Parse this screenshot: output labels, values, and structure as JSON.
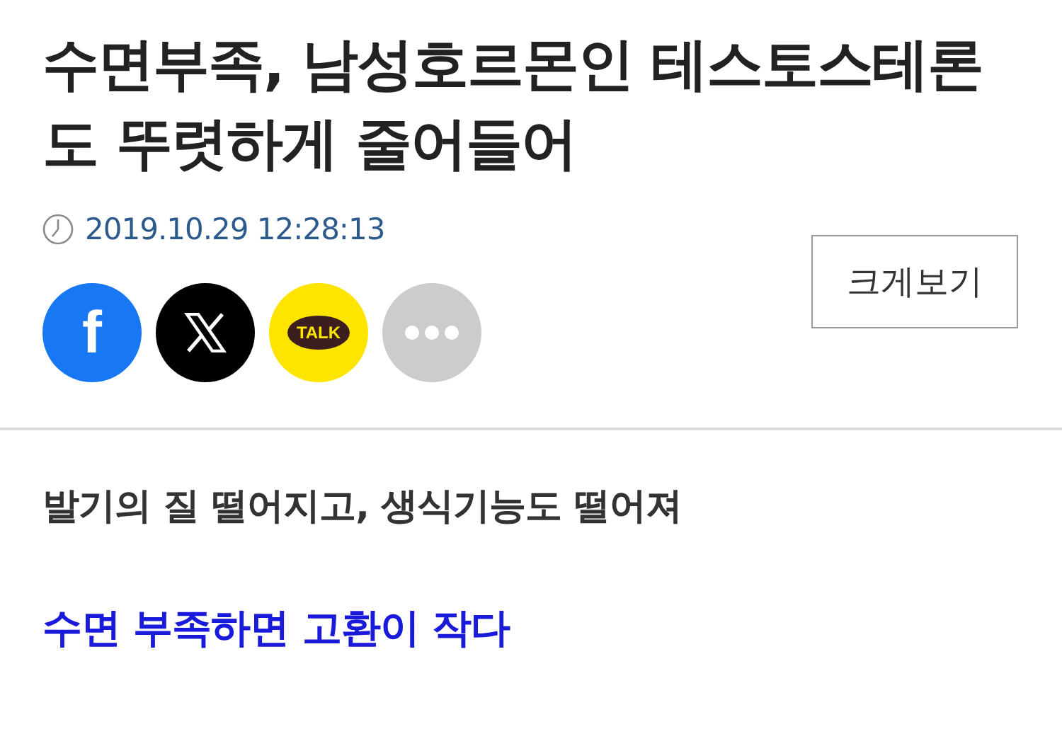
{
  "article": {
    "title": "수면부족, 남성호르몬인 테스토스테론도 뚜렷하게 줄어들어",
    "date": "2019.10.29 12:28:13",
    "zoom_button": "크게보기"
  },
  "share": [
    {
      "kind": "facebook",
      "label": "f"
    },
    {
      "kind": "x"
    },
    {
      "kind": "kakao",
      "label": "TALK"
    },
    {
      "kind": "more"
    }
  ],
  "subtitle": "발기의 질 떨어지고, 생식기능도 떨어져",
  "section_link": "수면 부족하면 고환이 작다"
}
